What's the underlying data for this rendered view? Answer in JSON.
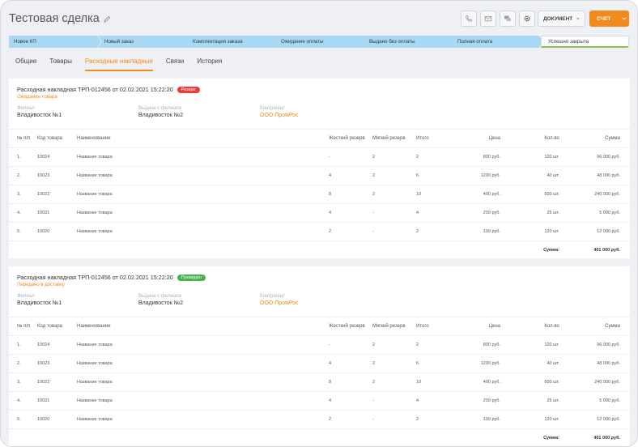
{
  "header": {
    "title": "Тестовая сделка",
    "document_label": "ДОКУМЕНТ",
    "bill_label": "СЧЕТ"
  },
  "colors": {
    "accent": "#f28a1c",
    "stage_active": "#a8d8f4",
    "reserve": "#ea3a3a",
    "posted": "#43b549"
  },
  "stages": [
    {
      "label": "Новое КП"
    },
    {
      "label": "Новый заказ"
    },
    {
      "label": "Комплектация заказа"
    },
    {
      "label": "Ожидание оплаты"
    },
    {
      "label": "Выдано без оплаты"
    },
    {
      "label": "Полная оплата"
    },
    {
      "label": "Успешно закрыта"
    }
  ],
  "tabs": [
    {
      "label": "Общие"
    },
    {
      "label": "Товары"
    },
    {
      "label": "Расходные накладные",
      "active": true
    },
    {
      "label": "Связи"
    },
    {
      "label": "История"
    }
  ],
  "columns": [
    "№ п/п",
    "Код товара",
    "Наименование",
    "Жесткий резерв",
    "Мягкий резерв",
    "Итого",
    "Цена",
    "Кол-во",
    "Сумма"
  ],
  "invoices": [
    {
      "title": "Расходная накладная ТРП-012456 от 02.02.2021 15:22:20",
      "badge": "Резерв",
      "substatus": "Ожидание товара",
      "fields": [
        {
          "label": "Филиал",
          "value": "Владивосток №1"
        },
        {
          "label": "Выдача с филиала",
          "value": "Владивосток №2"
        },
        {
          "label": "Контрагент",
          "value": "ООО ПромРос"
        }
      ],
      "rows": [
        [
          "1.",
          "10024",
          "Название товара",
          "-",
          "2",
          "2",
          "800 руб.",
          "120 шт.",
          "96 000 руб."
        ],
        [
          "2.",
          "10023",
          "Название товара",
          "4",
          "2",
          "6",
          "1200 руб.",
          "40 шт.",
          "48 000 руб."
        ],
        [
          "3.",
          "10022",
          "Название товара",
          "8",
          "2",
          "10",
          "400 руб.",
          "600 шт.",
          "240 000 руб."
        ],
        [
          "4.",
          "10021",
          "Название товара",
          "4",
          "-",
          "4",
          "200 руб.",
          "25 шт.",
          "5 000 руб."
        ],
        [
          "5.",
          "10020",
          "Название товара",
          "2",
          "-",
          "2",
          "100 руб.",
          "120 шт.",
          "12 000 руб."
        ]
      ],
      "total_label": "Сумма:",
      "total_value": "401 000 руб."
    },
    {
      "title": "Расходная накладная ТРП-012456 от 02.02.2021 15:22:20",
      "badge": "Проведен",
      "substatus": "Передано в доставку",
      "fields": [
        {
          "label": "Филиал",
          "value": "Владивосток №1"
        },
        {
          "label": "Выдача с филиала",
          "value": "Владивосток №2"
        },
        {
          "label": "Контрагент",
          "value": "ООО ПромРос"
        }
      ],
      "rows": [
        [
          "1.",
          "10024",
          "Название товара",
          "-",
          "2",
          "2",
          "800 руб.",
          "120 шт.",
          "96 000 руб."
        ],
        [
          "2.",
          "10023",
          "Название товара",
          "4",
          "2",
          "6",
          "1200 руб.",
          "40 шт.",
          "48 000 руб."
        ],
        [
          "3.",
          "10022",
          "Название товара",
          "8",
          "2",
          "10",
          "400 руб.",
          "600 шт.",
          "240 000 руб."
        ],
        [
          "4.",
          "10021",
          "Название товара",
          "4",
          "-",
          "4",
          "200 руб.",
          "25 шт.",
          "5 000 руб."
        ],
        [
          "5.",
          "10020",
          "Название товара",
          "2",
          "-",
          "2",
          "100 руб.",
          "120 шт.",
          "12 000 руб."
        ]
      ],
      "total_label": "Сумма:",
      "total_value": "401 000 руб."
    }
  ]
}
